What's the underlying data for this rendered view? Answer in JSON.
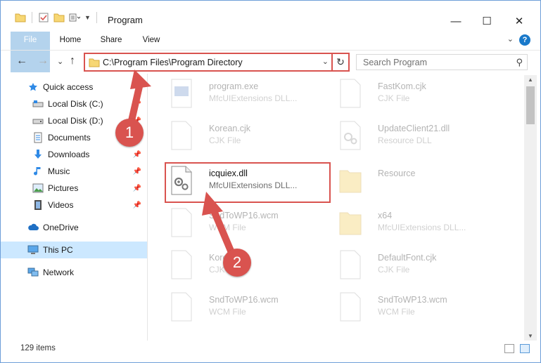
{
  "window": {
    "title": "Program",
    "minimize_glyph": "—",
    "maximize_glyph": "☐",
    "close_glyph": "✕"
  },
  "ribbon": {
    "tabs": [
      {
        "label": "File"
      },
      {
        "label": "Home"
      },
      {
        "label": "Share"
      },
      {
        "label": "View"
      }
    ],
    "expand_glyph": "⌄",
    "help_glyph": "?"
  },
  "navigation": {
    "back_glyph": "←",
    "forward_glyph": "→",
    "recent_glyph": "⌄",
    "up_glyph": "↑",
    "address_path": "C:\\Program Files\\Program Directory",
    "dropdown_glyph": "⌄",
    "refresh_glyph": "↻",
    "search_placeholder": "Search Program",
    "search_glyph": "⚲"
  },
  "sidebar": {
    "items": [
      {
        "label": "Quick access",
        "icon": "star-icon"
      },
      {
        "label": "Local Disk (C:)",
        "icon": "drive-icon",
        "pinned": true
      },
      {
        "label": "Local Disk (D:)",
        "icon": "drive-icon",
        "pinned": true
      },
      {
        "label": "Documents",
        "icon": "documents-icon",
        "pinned": true
      },
      {
        "label": "Downloads",
        "icon": "download-icon",
        "pinned": true
      },
      {
        "label": "Music",
        "icon": "music-icon",
        "pinned": true
      },
      {
        "label": "Pictures",
        "icon": "pictures-icon",
        "pinned": true
      },
      {
        "label": "Videos",
        "icon": "videos-icon",
        "pinned": true
      },
      {
        "label": "OneDrive",
        "icon": "cloud-icon"
      },
      {
        "label": "This PC",
        "icon": "computer-icon",
        "selected": true
      },
      {
        "label": "Network",
        "icon": "network-icon"
      }
    ],
    "pin_glyph": "📌"
  },
  "files": [
    {
      "name": "program.exe",
      "type": "MfcUIExtensions DLL..."
    },
    {
      "name": "FastKom.cjk",
      "type": "CJK File"
    },
    {
      "name": "Korean.cjk",
      "type": "CJK File"
    },
    {
      "name": "UpdateClient21.dll",
      "type": "Resource DLL"
    },
    {
      "name": "icquiex.dll",
      "type": "MfcUIExtensions DLL...",
      "highlighted": true
    },
    {
      "name": "Resource",
      "type": ""
    },
    {
      "name": "SndToWP16.wcm",
      "type": "WCM File"
    },
    {
      "name": "x64",
      "type": "MfcUIExtensions DLL..."
    },
    {
      "name": "Korea",
      "type": "CJK File"
    },
    {
      "name": "DefaultFont.cjk",
      "type": "CJK File"
    },
    {
      "name": "SndToWP16.wcm",
      "type": "WCM File"
    },
    {
      "name": "SndToWP13.wcm",
      "type": "WCM File"
    }
  ],
  "status": {
    "item_count": "129 items"
  },
  "callouts": {
    "step1": "1",
    "step2": "2"
  },
  "colors": {
    "accent": "#1979ca",
    "callout": "#d9534f",
    "selected_bg": "#cce8ff"
  }
}
